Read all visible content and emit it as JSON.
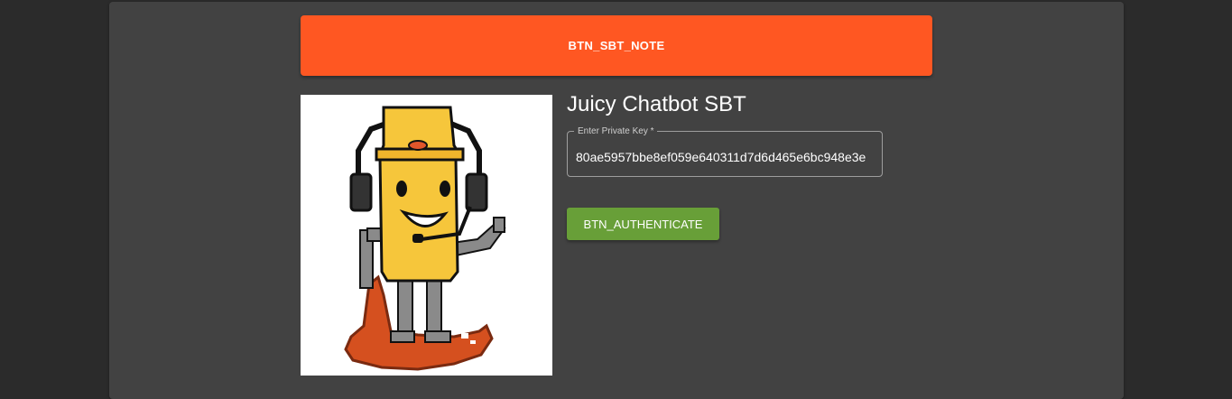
{
  "header": {
    "note_button_label": "BTN_SBT_NOTE"
  },
  "sbt": {
    "title": "Juicy Chatbot SBT",
    "image_icon": "juicy-chatbot-mascot"
  },
  "private_key_field": {
    "label": "Enter Private Key *",
    "value": "80ae5957bbe8ef059e640311d7d6d465e6bc948e3e"
  },
  "actions": {
    "authenticate_label": "BTN_AUTHENTICATE"
  },
  "colors": {
    "page_background": "#2b2b2b",
    "panel_background": "#424242",
    "note_button": "#ff5722",
    "authenticate_button": "#689f38"
  }
}
